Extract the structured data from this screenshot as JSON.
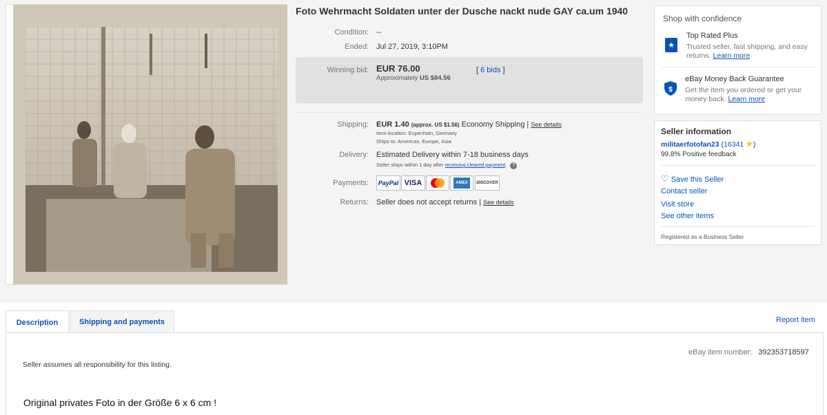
{
  "listing": {
    "title": "Foto Wehrmacht Soldaten unter der Dusche nackt nude GAY ca.um 1940",
    "condition_label": "Condition:",
    "condition_value": "--",
    "ended_label": "Ended:",
    "ended_value": "Jul 27, 2019, 3:10PM",
    "winning_bid_label": "Winning bid:",
    "winning_bid_value": "EUR 76.00",
    "approx_prefix": "Approximately",
    "approx_value": "US $84.56",
    "bids_open": "[",
    "bids_link": "6 bids",
    "bids_close": "]",
    "shipping_label": "Shipping:",
    "shipping_value": "EUR 1.40",
    "shipping_approx": "(approx. US $1.56)",
    "shipping_service": "Economy Shipping |",
    "see_details": "See details",
    "item_location": "Item location:  Espenhain, Germany",
    "ships_to": "Ships to:  Americas, Europe, Asia",
    "delivery_label": "Delivery:",
    "delivery_value": "Estimated Delivery within 7-18 business days",
    "delivery_sub": "Seller ships within 1 day after",
    "delivery_sub_link": "receiving cleared payment",
    "delivery_sub_end": ".",
    "payments_label": "Payments:",
    "payment_methods": [
      "PayPal",
      "VISA",
      "MasterCard",
      "AMEX",
      "DISCOVER"
    ],
    "returns_label": "Returns:",
    "returns_value": "Seller does not accept returns |",
    "returns_see_details": "See details"
  },
  "confidence": {
    "title": "Shop with confidence",
    "top_rated_title": "Top Rated Plus",
    "top_rated_sub_1": "Trusted seller, fast shipping, and easy",
    "top_rated_sub_2": "returns.",
    "learn_more": "Learn more",
    "guarantee_title": "eBay Money Back Guarantee",
    "guarantee_sub_1": "Get the item you ordered or get your",
    "guarantee_sub_2": "money back.",
    "learn_more_2": "Learn more"
  },
  "seller": {
    "title": "Seller information",
    "name": "militaerfotofan23",
    "score_open": "(",
    "score": "16341",
    "score_close": ")",
    "feedback": "99.8% Positive feedback",
    "save": "Save this Seller",
    "contact": "Contact seller",
    "visit": "Visit store",
    "other": "See other items",
    "registered": "Registered as a Business Seller"
  },
  "tabs": {
    "description": "Description",
    "shipping": "Shipping and payments",
    "report": "Report item"
  },
  "content": {
    "item_number_label": "eBay item number:",
    "item_number": "392353718597",
    "responsibility": "Seller assumes all responsibility for this listing.",
    "original_text": "Original privates Foto in der Größe 6 x 6 cm !"
  },
  "colors": {
    "link": "#0654ba",
    "bid_box": "#e1e1e1",
    "star": "#f5c518"
  }
}
